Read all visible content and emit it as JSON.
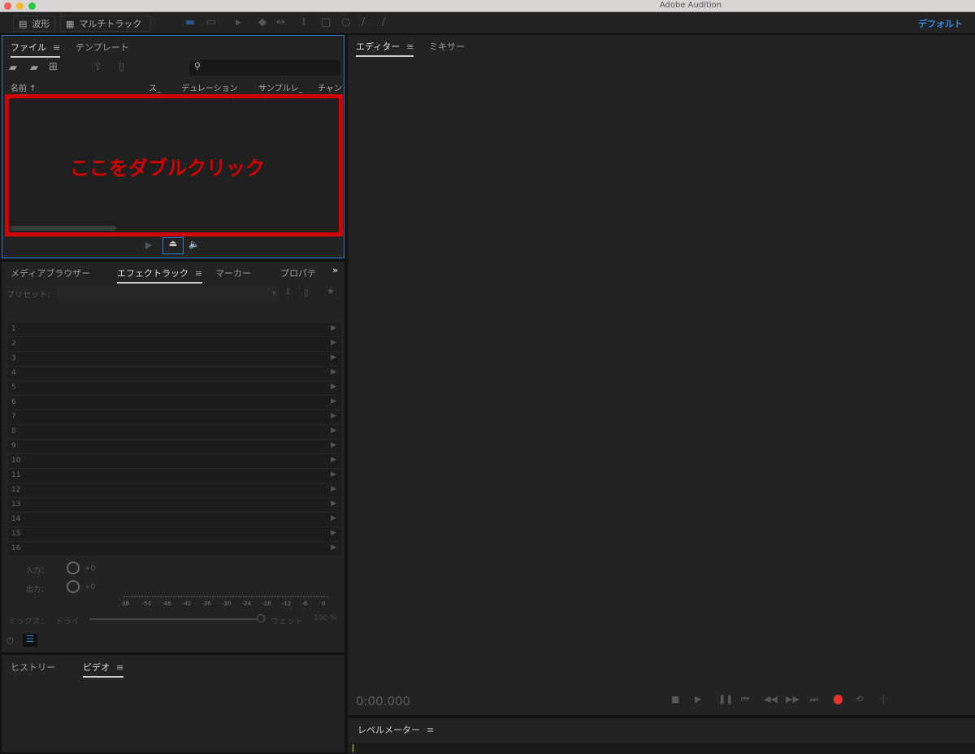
{
  "window": {
    "title": "Adobe Audition"
  },
  "toolbar": {
    "waveform": "波形",
    "multitrack": "マルチトラック",
    "workspace": "デフォルト"
  },
  "files_panel": {
    "tabs": [
      "ファイル",
      "テンプレート"
    ],
    "columns": [
      "名前",
      "ス_",
      "デュレーション",
      "サンプルレ_",
      "チャン"
    ],
    "search_placeholder": "",
    "annotation": "ここをダブルクリック"
  },
  "effects_panel": {
    "tabs": [
      "メディアブラウザー",
      "エフェクトラック",
      "マーカー",
      "プロパテ"
    ],
    "preset_label": "プリセット：",
    "rows": [
      "1",
      "2",
      "3",
      "4",
      "5",
      "6",
      "7",
      "8",
      "9",
      "10",
      "11",
      "12",
      "13",
      "14",
      "15",
      "16"
    ],
    "input_label": "入力：",
    "input_value": "+0",
    "output_label": "出力：",
    "output_value": "+0",
    "scale": [
      "dB",
      "-54",
      "-48",
      "-42",
      "-36",
      "-30",
      "-24",
      "-18",
      "-12",
      "-6",
      "0"
    ],
    "mix_label": "ミックス：",
    "dry_label": "ドライ",
    "wet_label": "ウェット",
    "mix_value": "100 %"
  },
  "bottom_left_panel": {
    "tabs": [
      "ヒストリー",
      "ビデオ"
    ]
  },
  "editor": {
    "tabs": [
      "エディター",
      "ミキサー"
    ],
    "time": "0:00.000"
  },
  "level_meter": {
    "title": "レベルメーター"
  },
  "colors": {
    "accent": "#2d8ceb",
    "annotation": "#d40000",
    "record": "#e8312f"
  }
}
